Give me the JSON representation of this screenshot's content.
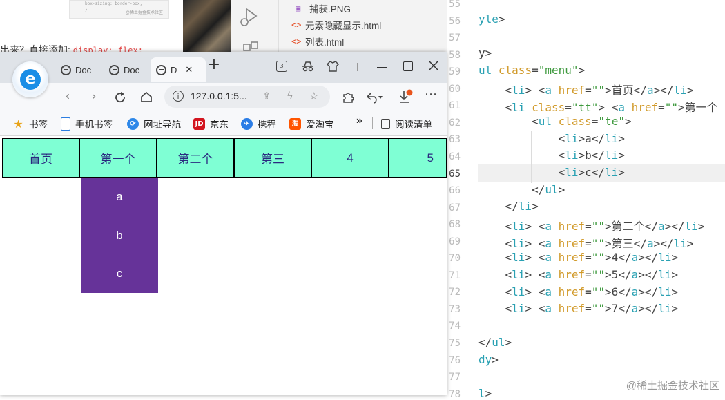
{
  "background_doc": {
    "thumb_code": "box-sizing: border-box;",
    "thumb_brace": "}",
    "thumb_watermark": "@稀土掘金技术社区",
    "text": "出来？直接添加:",
    "code": "display: flex;"
  },
  "explorer": {
    "files": [
      {
        "name": "捕获.PNG",
        "icon": "image-icon"
      },
      {
        "name": "元素隐藏显示.html",
        "icon": "html-icon"
      },
      {
        "name": "列表.html",
        "icon": "html-icon"
      }
    ]
  },
  "editor": {
    "line_numbers": [
      "55",
      "56",
      "57",
      "58",
      "59",
      "60",
      "61",
      "62",
      "63",
      "64",
      "65",
      "66",
      "67",
      "68",
      "69",
      "70",
      "71",
      "72",
      "73",
      "74",
      "75",
      "76",
      "77",
      "78"
    ],
    "active_line": "65",
    "watermark": "@稀土掘金技术社区"
  },
  "browser": {
    "tabs": [
      {
        "label": "Doc"
      },
      {
        "label": "Doc"
      },
      {
        "label": "D"
      }
    ],
    "close_tab_glyph": "✕",
    "new_tab_glyph": "+",
    "tab_count_badge": "3",
    "url": "127.0.0.1:5...",
    "bookmarks": [
      {
        "label": "书签",
        "icon": "star-icon"
      },
      {
        "label": "手机书签",
        "icon": "phone-bookmark-icon"
      },
      {
        "label": "网址导航",
        "icon": "compass-icon"
      },
      {
        "label": "京东",
        "icon": "jd-icon",
        "badge": "JD"
      },
      {
        "label": "携程",
        "icon": "ctrip-icon"
      },
      {
        "label": "爱淘宝",
        "icon": "taobao-icon",
        "badge": "淘"
      }
    ],
    "more_bookmarks": "»",
    "reading_list": "阅读清单"
  },
  "page": {
    "menu": [
      "首页",
      "第一个",
      "第二个",
      "第三",
      "4",
      "5"
    ],
    "submenu": [
      "a",
      "b",
      "c"
    ],
    "colors": {
      "menu_bg": "#7fffd4",
      "submenu_bg": "#663399"
    }
  }
}
